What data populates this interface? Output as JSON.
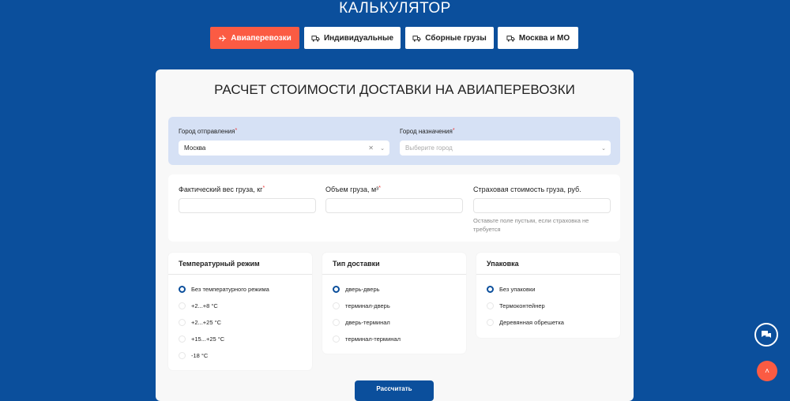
{
  "header": {
    "title": "КАЛЬКУЛЯТОР"
  },
  "tabs": [
    {
      "label": "Авиаперевозки",
      "icon": "airplane-icon",
      "active": true
    },
    {
      "label": "Индивидуальные",
      "icon": "truck-icon"
    },
    {
      "label": "Сборные грузы",
      "icon": "truck-icon"
    },
    {
      "label": "Москва и МО",
      "icon": "truck-icon"
    }
  ],
  "form": {
    "title": "РАСЧЕТ СТОИМОСТИ ДОСТАВКИ НА АВИАПЕРЕВОЗКИ",
    "from": {
      "label": "Город отправления",
      "value": "Москва"
    },
    "to": {
      "label": "Город назначения",
      "placeholder": "Выберите город"
    },
    "weight": {
      "label": "Фактический вес груза, кг"
    },
    "volume": {
      "label": "Объем груза, м³"
    },
    "insurance": {
      "label": "Страховая стоимость груза, руб.",
      "hint": "Оставьте поле пустым, если страховка не требуется"
    },
    "required_mark": "*",
    "temperature": {
      "title": "Температурный режим",
      "options": [
        "Без температурного режима",
        "+2...+8 °C",
        "+2...+25 °C",
        "+15...+25 °C",
        "-18 °C"
      ],
      "selected": 0
    },
    "delivery": {
      "title": "Тип доставки",
      "options": [
        "дверь-дверь",
        "терминал-дверь",
        "дверь-терминал",
        "терминал-терминал"
      ],
      "selected": 0
    },
    "packing": {
      "title": "Упаковка",
      "options": [
        "Без упаковки",
        "Термоконтейнер",
        "Деревянная обрешетка"
      ],
      "selected": 0
    },
    "submit": "Рассчитать"
  },
  "colors": {
    "brand": "#0b4f9c",
    "accent": "#fb5b43"
  }
}
